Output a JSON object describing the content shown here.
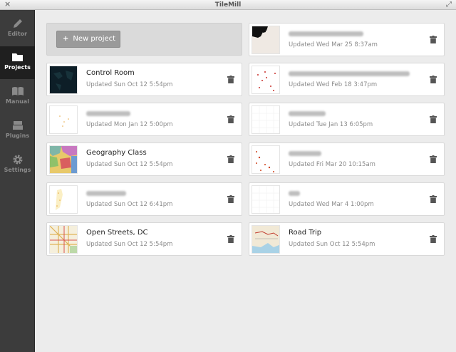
{
  "window": {
    "title": "TileMill",
    "close_glyph": "×",
    "maximize_glyph": "⤢"
  },
  "sidebar": {
    "items": [
      {
        "label": "Editor",
        "icon": "pencil-icon",
        "active": false
      },
      {
        "label": "Projects",
        "icon": "folder-icon",
        "active": true
      },
      {
        "label": "Manual",
        "icon": "book-icon",
        "active": false
      },
      {
        "label": "Plugins",
        "icon": "plugins-icon",
        "active": false
      },
      {
        "label": "Settings",
        "icon": "gear-icon",
        "active": false
      }
    ]
  },
  "new_project": {
    "plus": "+",
    "label": "New project"
  },
  "projects": [
    {
      "name": "",
      "updated": "Updated Wed Mar 25 8:37am",
      "name_obscured": true
    },
    {
      "name": "Control Room",
      "updated": "Updated Sun Oct 12 5:54pm",
      "name_obscured": false
    },
    {
      "name": "",
      "updated": "Updated Wed Feb 18 3:47pm",
      "name_obscured": true
    },
    {
      "name": "",
      "updated": "Updated Mon Jan 12 5:00pm",
      "name_obscured": true
    },
    {
      "name": "",
      "updated": "Updated Tue Jan 13 6:05pm",
      "name_obscured": true
    },
    {
      "name": "Geography Class",
      "updated": "Updated Sun Oct 12 5:54pm",
      "name_obscured": false
    },
    {
      "name": "",
      "updated": "Updated Fri Mar 20 10:15am",
      "name_obscured": true
    },
    {
      "name": "",
      "updated": "Updated Sun Oct 12 6:41pm",
      "name_obscured": true
    },
    {
      "name": "",
      "updated": "Updated Wed Mar 4 1:00pm",
      "name_obscured": true
    },
    {
      "name": "Open Streets, DC",
      "updated": "Updated Sun Oct 12 5:54pm",
      "name_obscured": false
    },
    {
      "name": "Road Trip",
      "updated": "Updated Sun Oct 12 5:54pm",
      "name_obscured": false
    }
  ],
  "colors": {
    "sidebar": "#3c3c3c",
    "sidebar_active": "#1f1f1f",
    "background": "#ececec",
    "new_button": "#9a9a9a"
  }
}
